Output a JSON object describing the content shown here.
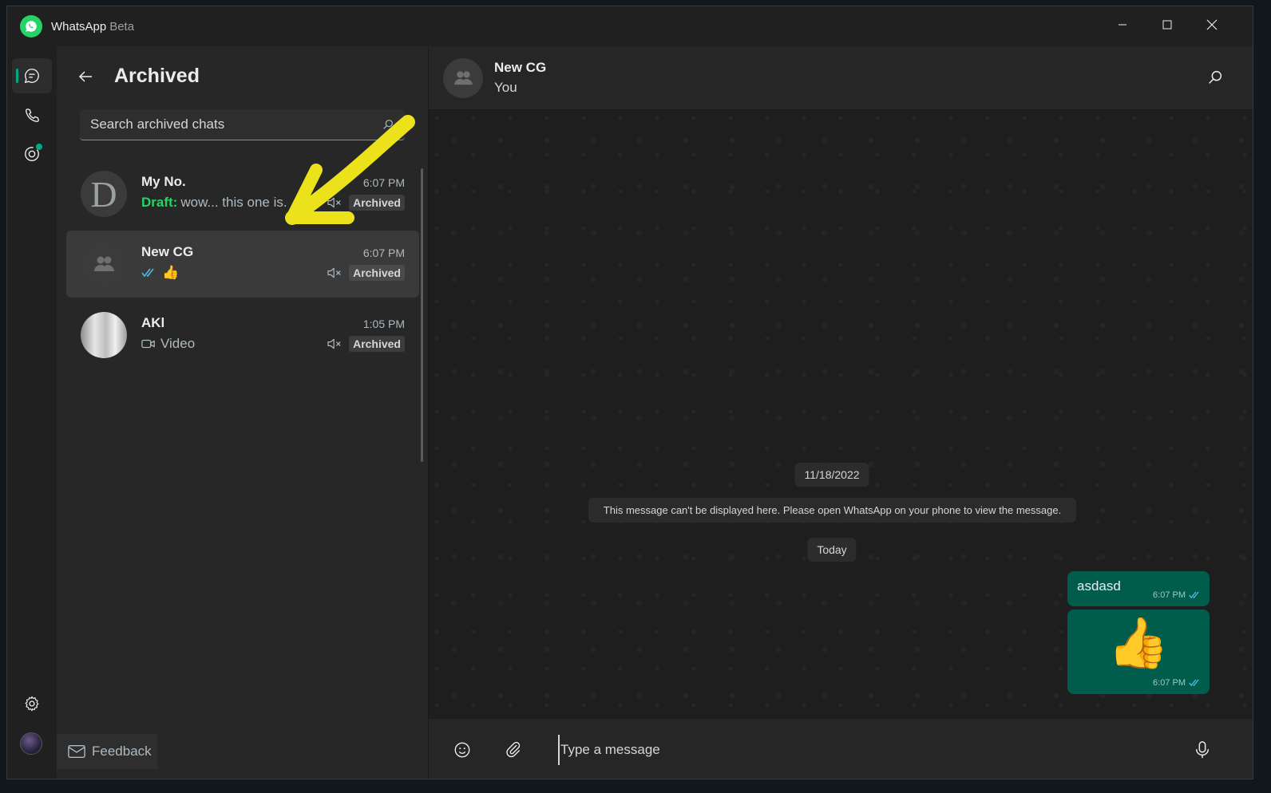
{
  "app": {
    "name": "WhatsApp",
    "badge": "Beta"
  },
  "sidebar": {
    "title": "Archived",
    "search_placeholder": "Search archived chats",
    "chats": [
      {
        "name": "My No.",
        "time": "6:07 PM",
        "draft_label": "Draft:",
        "preview": "wow... this one is.",
        "badge": "Archived",
        "avatar_letter": "D"
      },
      {
        "name": "New CG",
        "time": "6:07 PM",
        "preview": "👍",
        "badge": "Archived"
      },
      {
        "name": "AKl",
        "time": "1:05 PM",
        "preview": "Video",
        "badge": "Archived"
      }
    ],
    "feedback_label": "Feedback"
  },
  "conversation": {
    "name": "New CG",
    "subtitle": "You",
    "date_chip_1": "11/18/2022",
    "system_message": "This message can't be displayed here. Please open WhatsApp on your phone to view the message.",
    "date_chip_2": "Today",
    "messages": [
      {
        "text": "asdasd",
        "time": "6:07 PM"
      },
      {
        "emoji": "👍",
        "time": "6:07 PM"
      }
    ],
    "composer_placeholder": "Type a message"
  },
  "colors": {
    "accent": "#00a884",
    "bubble_out": "#005c4b",
    "draft": "#25d366",
    "read_ticks": "#53bdeb"
  }
}
